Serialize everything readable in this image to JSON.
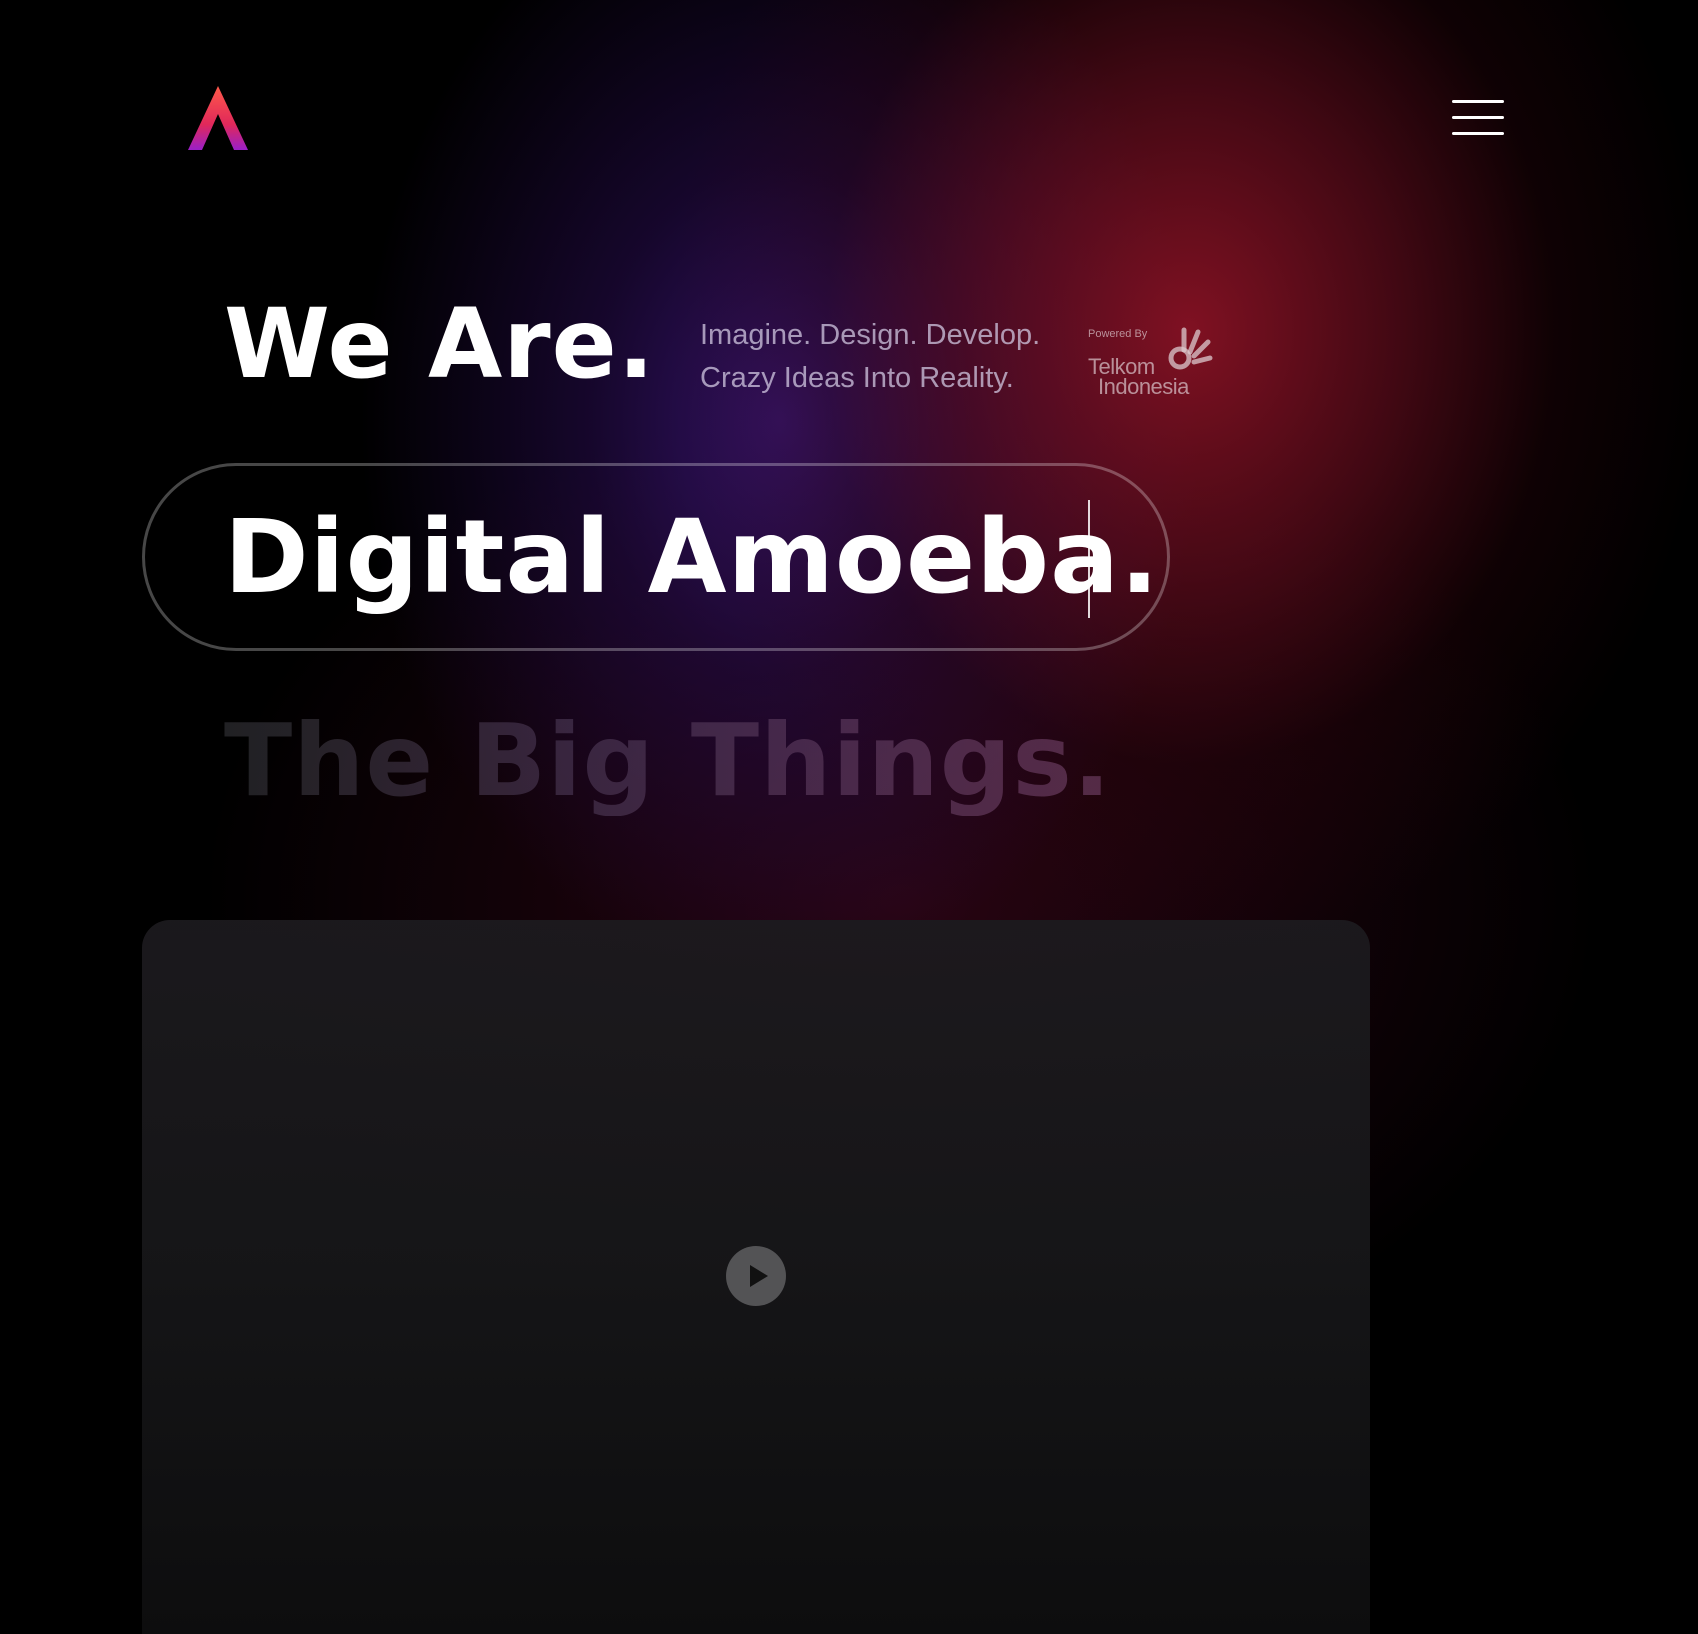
{
  "header": {
    "logo_icon": "amoeba-a-logo-icon",
    "menu_icon": "hamburger-menu-icon"
  },
  "hero": {
    "line1": "We Are.",
    "line2": "Digital Amoeba.",
    "line3": "The Big Things."
  },
  "tagline": {
    "line1": "Imagine. Design. Develop.",
    "line2": "Crazy Ideas Into Reality."
  },
  "partner": {
    "powered_by": "Powered By",
    "name_line1": "Telkom",
    "name_line2": "Indonesia",
    "icon": "telkom-hand-icon"
  },
  "video": {
    "play_icon": "play-icon"
  },
  "colors": {
    "background": "#000000",
    "glow_red": "#96142a",
    "glow_purple": "#37146e",
    "logo_gradient_top": "#ff5a4a",
    "logo_gradient_bottom": "#a020c0",
    "text_primary": "#ffffff"
  }
}
